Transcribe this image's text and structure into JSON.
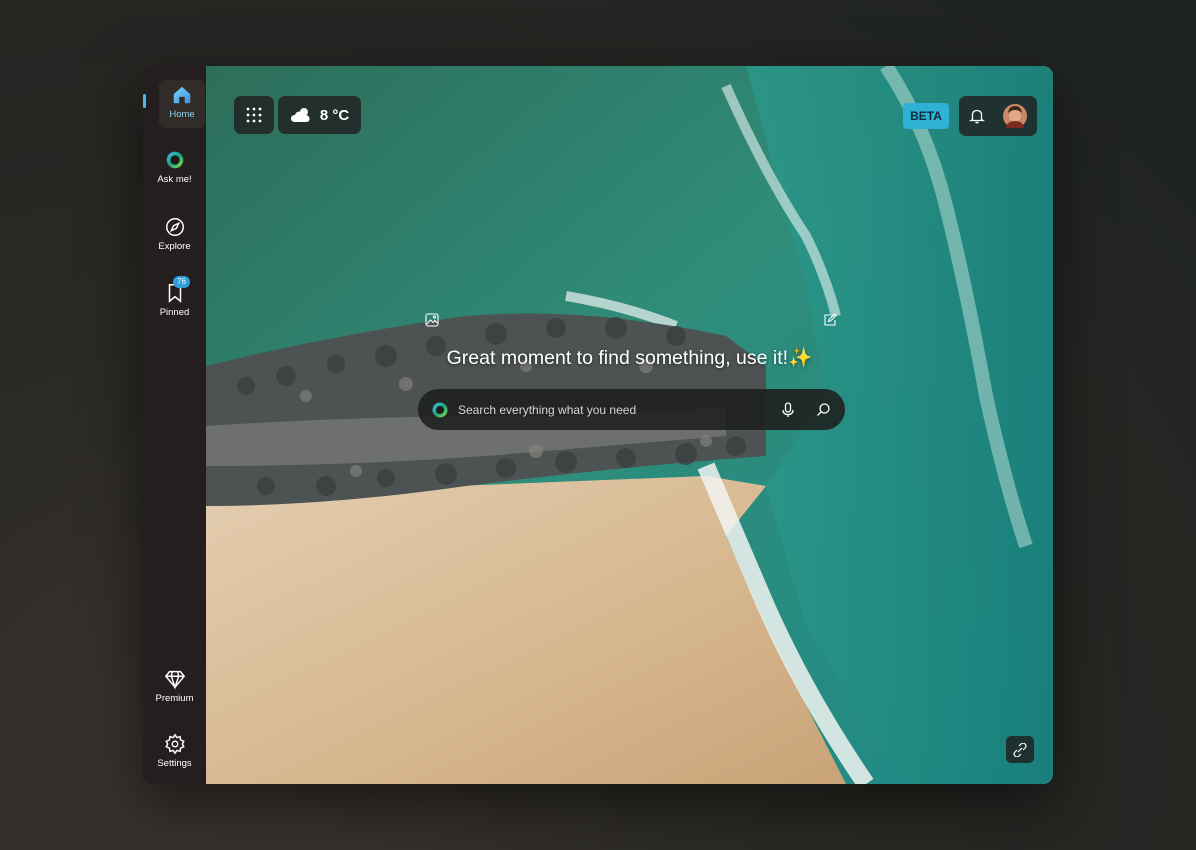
{
  "sidebar": {
    "items": [
      {
        "label": "Home",
        "icon": "home-icon"
      },
      {
        "label": "Ask me!",
        "icon": "ask-me-orb-icon"
      },
      {
        "label": "Explore",
        "icon": "compass-icon"
      },
      {
        "label": "Pinned",
        "icon": "bookmark-icon",
        "badge": "76"
      },
      {
        "label": "Premium",
        "icon": "diamond-icon"
      },
      {
        "label": "Settings",
        "icon": "gear-icon"
      }
    ]
  },
  "header": {
    "weather": {
      "temperature": "8 °C",
      "icon": "cloud-sun-icon"
    },
    "beta_label": "BETA"
  },
  "main": {
    "headline": "Great moment to find something, use it!✨",
    "search_placeholder": "Search everything what you need"
  },
  "colors": {
    "accent": "#4fb6e6",
    "beta_bg": "#2fb1d6",
    "sidebar_bg": "#241f1e",
    "sea": "#2a8a78",
    "sand": "#d9bf9c"
  }
}
